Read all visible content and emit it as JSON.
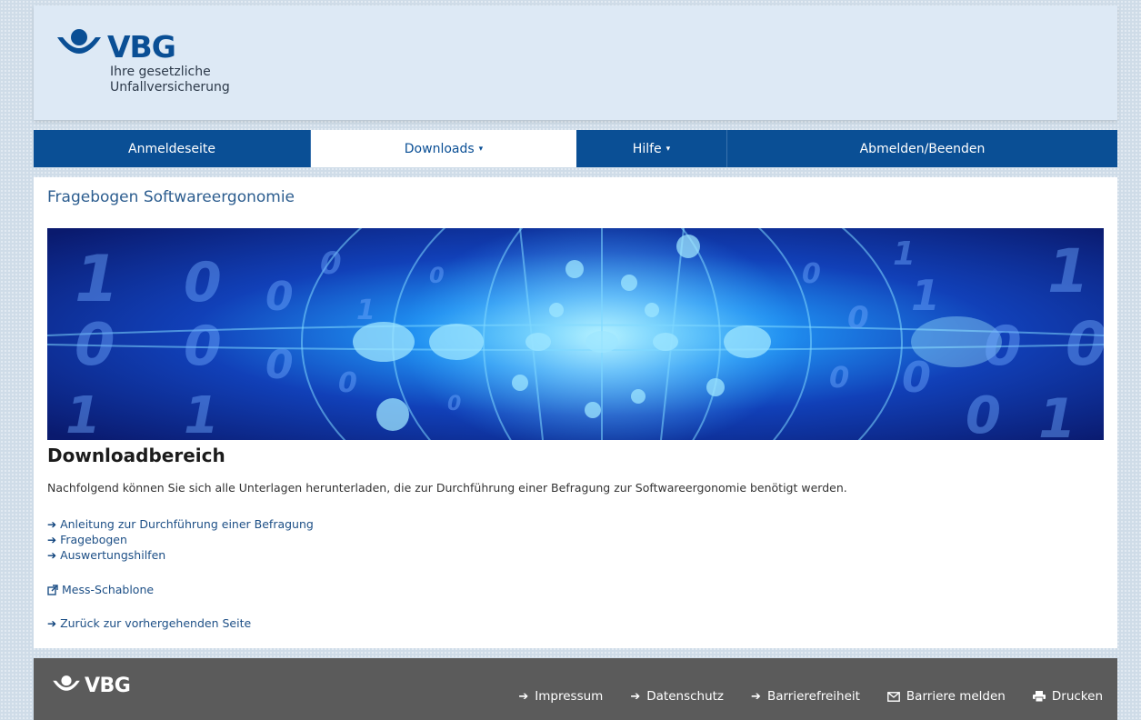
{
  "header": {
    "logo_text": "VBG",
    "tagline_line1": "Ihre gesetzliche",
    "tagline_line2": "Unfallversicherung"
  },
  "nav": {
    "items": [
      {
        "label": "Anmeldeseite",
        "has_dropdown": false,
        "active": false
      },
      {
        "label": "Downloads",
        "has_dropdown": true,
        "active": true
      },
      {
        "label": "Hilfe",
        "has_dropdown": true,
        "active": false
      },
      {
        "label": "Abmelden/Beenden",
        "has_dropdown": false,
        "active": false
      }
    ],
    "caret": "▾"
  },
  "main": {
    "page_title": "Fragebogen Softwareergonomie",
    "section_heading": "Downloadbereich",
    "intro": "Nachfolgend können Sie sich alle Unterlagen herunterladen, die zur Durchführung einer Befragung zur Softwareergonomie benötigt werden.",
    "links": [
      "Anleitung zur Durchführung einer Befragung",
      "Fragebogen",
      "Auswertungshilfen"
    ],
    "external_link": "Mess-Schablone",
    "back_link": "Zurück zur vorhergehenden Seite"
  },
  "footer": {
    "logo_text": "VBG",
    "links": [
      {
        "label": "Impressum",
        "icon": "arrow-right-icon"
      },
      {
        "label": "Datenschutz",
        "icon": "arrow-right-icon"
      },
      {
        "label": "Barrierefreiheit",
        "icon": "arrow-right-icon"
      },
      {
        "label": "Barriere melden",
        "icon": "envelope-icon"
      },
      {
        "label": "Drucken",
        "icon": "printer-icon"
      }
    ]
  },
  "colors": {
    "primary_blue": "#0a4f95",
    "link_blue": "#1d4f86",
    "footer_gray": "#5b5b5b",
    "header_bg": "#dde9f5"
  }
}
